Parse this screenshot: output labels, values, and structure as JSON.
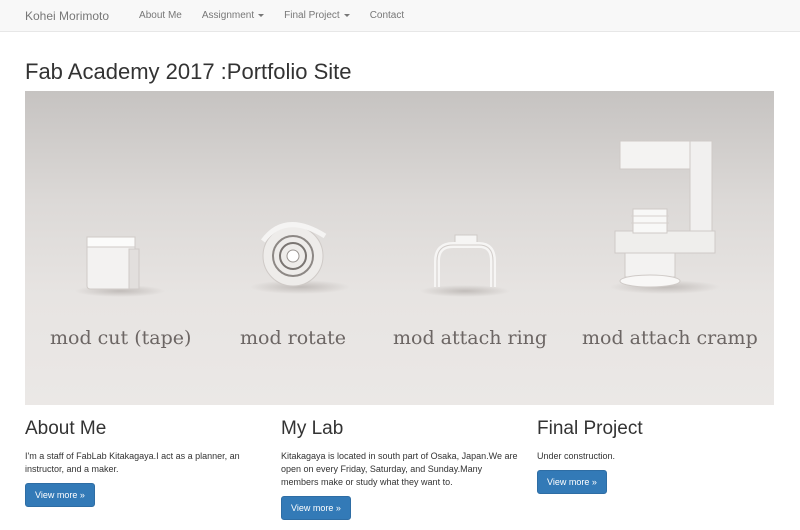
{
  "navbar": {
    "brand": "Kohei Morimoto",
    "items": [
      {
        "label": "About Me",
        "dropdown": false
      },
      {
        "label": "Assignment",
        "dropdown": true
      },
      {
        "label": "Final Project",
        "dropdown": true
      },
      {
        "label": "Contact",
        "dropdown": false
      }
    ]
  },
  "page": {
    "title": "Fab Academy 2017 :Portfolio Site"
  },
  "hero": {
    "labels": [
      "mod cut (tape)",
      "mod rotate",
      "mod attach ring",
      "mod attach cramp"
    ]
  },
  "sections": [
    {
      "title": "About Me",
      "text": "I'm a staff of FabLab Kitakagaya.I act as a planner, an instructor, and a maker.",
      "button": "View more »"
    },
    {
      "title": "My Lab",
      "text": "Kitakagaya is located in south part of Osaka, Japan.We are open on every Friday, Saturday, and Sunday.Many members make or study what they want to.",
      "button": "View more »"
    },
    {
      "title": "Final Project",
      "text": "Under construction.",
      "button": "View more »"
    }
  ],
  "colors": {
    "nav_bg": "#f8f8f8",
    "button_bg": "#337ab7",
    "hero_bg": "#e8e5e3"
  }
}
